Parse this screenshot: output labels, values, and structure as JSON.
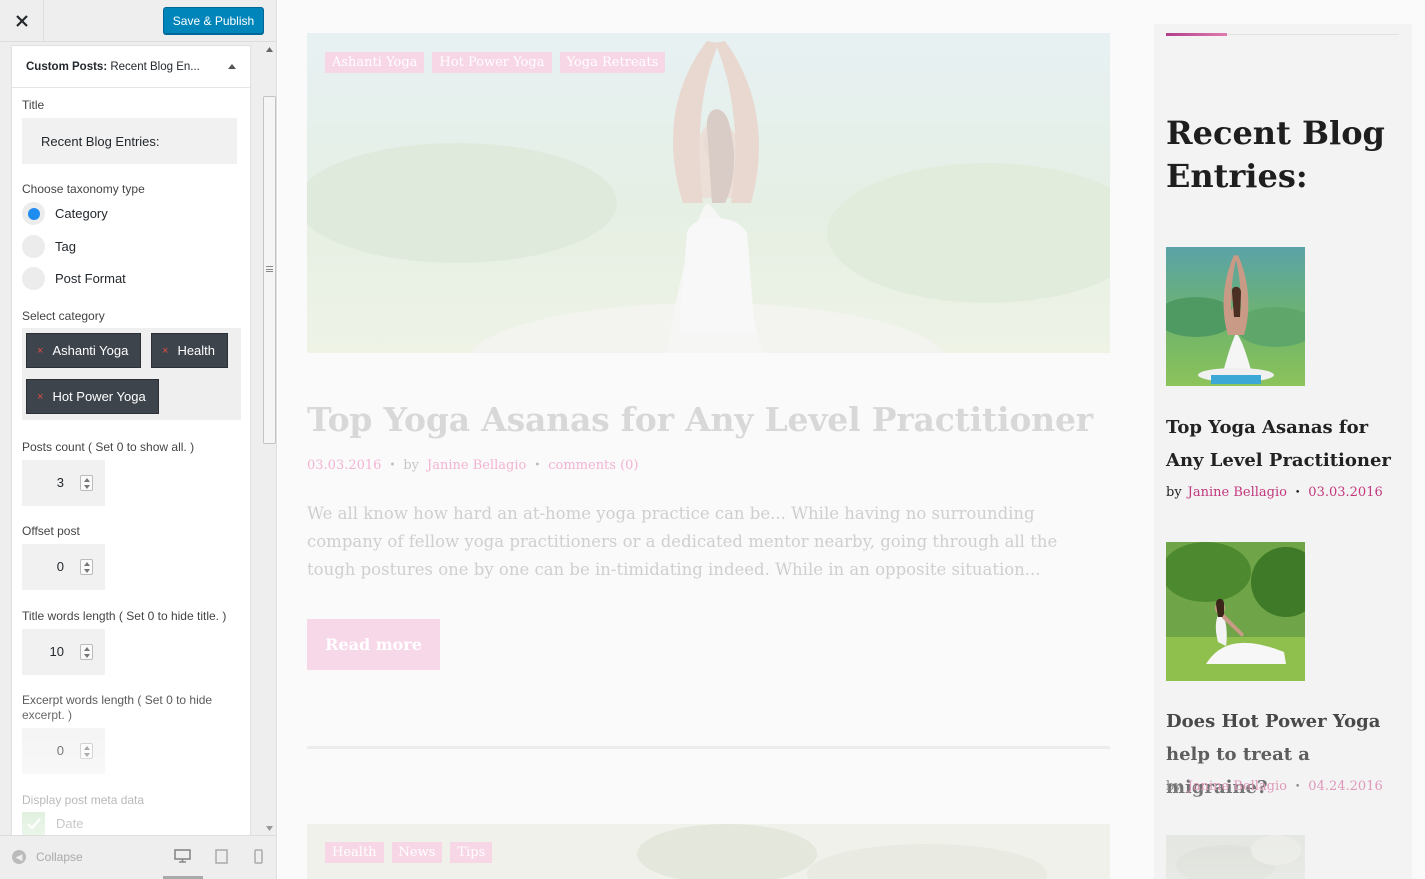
{
  "customizer": {
    "close_label": "×",
    "publish_label": "Save & Publish",
    "widget_title_bold": "Custom Posts:",
    "widget_title_rest": " Recent Blog En...",
    "fields": {
      "title_label": "Title",
      "title_value": "Recent Blog Entries:",
      "taxonomy_label": "Choose taxonomy type",
      "taxonomy_options": [
        "Category",
        "Tag",
        "Post Format"
      ],
      "taxonomy_selected": "Category",
      "category_label": "Select category",
      "selected_categories": [
        "Ashanti Yoga",
        "Health",
        "Hot Power Yoga"
      ],
      "posts_count_label": "Posts count ( Set 0 to show all. )",
      "posts_count_value": "3",
      "offset_label": "Offset post",
      "offset_value": "0",
      "title_words_label": "Title words length ( Set 0 to hide title. )",
      "title_words_value": "10",
      "excerpt_words_label": "Excerpt words length ( Set 0 to hide excerpt. )",
      "excerpt_words_value": "0",
      "meta_label": "Display post meta data",
      "meta_date_label": "Date"
    },
    "footer": {
      "collapse_label": "Collapse"
    }
  },
  "preview": {
    "post1": {
      "tags": [
        "Ashanti Yoga",
        "Hot Power Yoga",
        "Yoga Retreats"
      ],
      "title": "Top Yoga Asanas for Any Level Practitioner",
      "date": "03.03.2016",
      "by": "by",
      "author": "Janine Bellagio",
      "comments": "comments (0)",
      "excerpt": "We all know how hard an at-home yoga practice can be... While having no surrounding company of fellow yoga practitioners or a dedicated mentor nearby, going through all the tough postures one by one can be in-timidating indeed. While in an opposite situation...",
      "read_more": "Read more"
    },
    "post2": {
      "tags": [
        "Health",
        "News",
        "Tips"
      ]
    },
    "sidebar": {
      "title": "Recent Blog Entries:",
      "posts": [
        {
          "title": "Top Yoga Asanas for Any Level Practitioner",
          "by": "by",
          "author": "Janine Bellagio",
          "date": "03.03.2016"
        },
        {
          "title": "Does Hot Power Yoga help to treat a migraine?",
          "by": "by",
          "author": "Janine Bellagio",
          "date": "04.24.2016"
        }
      ]
    }
  },
  "colors": {
    "publish_button": "#0085ba",
    "radio_selected": "#1e8cf0",
    "chip_background": "#3e444c",
    "accent_pink": "#c2387d",
    "accent_gradient_start": "#b13f8b"
  }
}
